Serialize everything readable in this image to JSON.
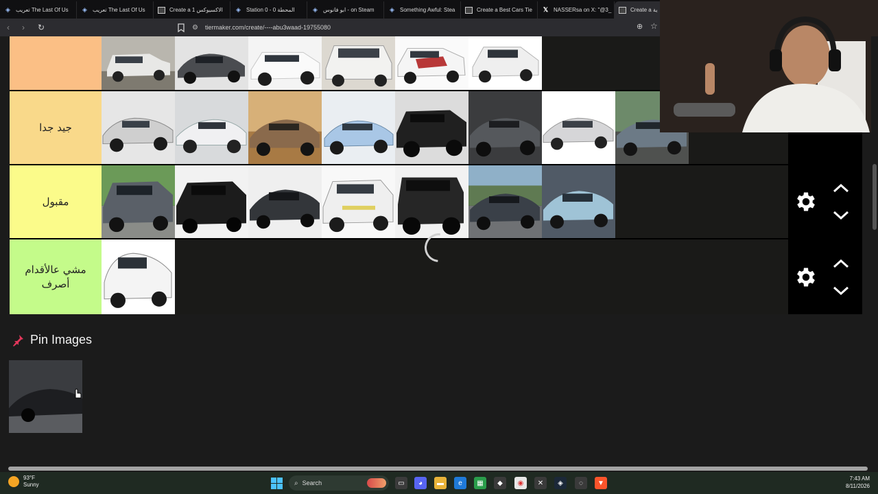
{
  "browser": {
    "tabs": [
      {
        "label": "تعريب The Last Of Us",
        "icon": "steam-icon"
      },
      {
        "label": "تعريب The Last Of Us",
        "icon": "steam-icon"
      },
      {
        "label": "Create a 1 الاكسيوكس",
        "icon": "tiermaker-icon"
      },
      {
        "label": "Station 0 - 0 المحطة",
        "icon": "steam-icon"
      },
      {
        "label": "ابو فانوس - on Steam",
        "icon": "steam-icon"
      },
      {
        "label": "Something Awful: Stea",
        "icon": "steam-icon"
      },
      {
        "label": "Create a Best Cars Tie",
        "icon": "tiermaker-icon"
      },
      {
        "label": "NASSERsa on X: \"@3_",
        "icon": "x-icon"
      },
      {
        "label": "Create a ية",
        "icon": "tiermaker-icon"
      }
    ],
    "url": "tiermaker.com/create/----abu3waad-19755080"
  },
  "tiers": [
    {
      "label": "",
      "color": "#fbbf85",
      "car_count": 6
    },
    {
      "label": "جيد جدا",
      "color": "#f9d98a",
      "car_count": 8
    },
    {
      "label": "مقبول",
      "color": "#fbfb8a",
      "car_count": 7
    },
    {
      "label": "مشي عالأقدام أصرف",
      "color": "#c4fb8a",
      "car_count": 1
    }
  ],
  "pin_images": {
    "heading": "Pin Images"
  },
  "taskbar": {
    "temperature": "93°F",
    "condition": "Sunny",
    "search_label": "Search",
    "time": "7:43 AM",
    "date": "8/11/2026"
  }
}
